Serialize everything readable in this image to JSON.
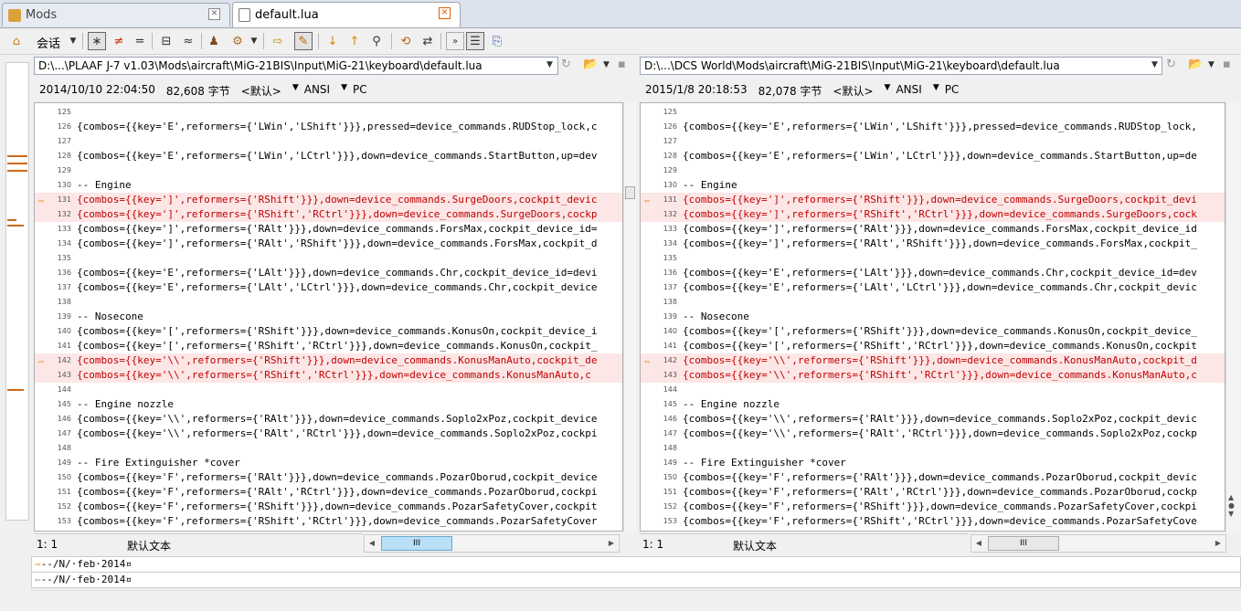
{
  "tabs": [
    {
      "label": "Mods",
      "active": false
    },
    {
      "label": "default.lua",
      "active": true
    }
  ],
  "toolbar": {
    "session_label": "会话",
    "icons": [
      "home-icon",
      "session-dropdown-icon",
      "show-all-icon",
      "show-diff-icon",
      "show-same-icon",
      "context-icon",
      "ignore-icon",
      "rules-icon",
      "format-icon",
      "next-section-icon",
      "edit-icon",
      "next-diff-icon",
      "prev-diff-icon",
      "find-icon",
      "sync-icon",
      "swap-icon",
      "expand-icon",
      "columns-icon",
      "refresh-icon"
    ]
  },
  "left": {
    "path": "D:\\...\\PLAAF J-7 v1.03\\Mods\\aircraft\\MiG-21BIS\\Input\\MiG-21\\keyboard\\default.lua",
    "date": "2014/10/10 22:04:50",
    "size": "82,608 字节",
    "encoding_default": "<默认>",
    "charset": "ANSI",
    "lineend": "PC",
    "status_pos": "1: 1",
    "status_text": "默认文本",
    "thumb_label": "III"
  },
  "right": {
    "path": "D:\\...\\DCS World\\Mods\\aircraft\\MiG-21BIS\\Input\\MiG-21\\keyboard\\default.lua",
    "date": "2015/1/8 20:18:53",
    "size": "82,078 字节",
    "encoding_default": "<默认>",
    "charset": "ANSI",
    "lineend": "PC",
    "status_pos": "1: 1",
    "status_text": "默认文本",
    "thumb_label": "III"
  },
  "left_lines": [
    {
      "n": "125",
      "t": "",
      "d": false
    },
    {
      "n": "126",
      "t": "{combos={{key='E',reformers={'LWin','LShift'}}},pressed=device_commands.RUDStop_lock,c",
      "d": false
    },
    {
      "n": "127",
      "t": "",
      "d": false
    },
    {
      "n": "128",
      "t": "{combos={{key='E',reformers={'LWin','LCtrl'}}},down=device_commands.StartButton,up=dev",
      "d": false
    },
    {
      "n": "129",
      "t": "",
      "d": false
    },
    {
      "n": "130",
      "t": "-- Engine",
      "d": false
    },
    {
      "n": "131",
      "t": "{combos={{key=']',reformers={'RShift'}}},down=device_commands.SurgeDoors,cockpit_devic",
      "d": true,
      "a": true
    },
    {
      "n": "132",
      "t": "{combos={{key=']',reformers={'RShift','RCtrl'}}},down=device_commands.SurgeDoors,cockp",
      "d": true
    },
    {
      "n": "133",
      "t": "{combos={{key=']',reformers={'RAlt'}}},down=device_commands.ForsMax,cockpit_device_id=",
      "d": false
    },
    {
      "n": "134",
      "t": "{combos={{key=']',reformers={'RAlt','RShift'}}},down=device_commands.ForsMax,cockpit_d",
      "d": false
    },
    {
      "n": "135",
      "t": "",
      "d": false
    },
    {
      "n": "136",
      "t": "{combos={{key='E',reformers={'LAlt'}}},down=device_commands.Chr,cockpit_device_id=devi",
      "d": false
    },
    {
      "n": "137",
      "t": "{combos={{key='E',reformers={'LAlt','LCtrl'}}},down=device_commands.Chr,cockpit_device",
      "d": false
    },
    {
      "n": "138",
      "t": "",
      "d": false
    },
    {
      "n": "139",
      "t": "-- Nosecone",
      "d": false
    },
    {
      "n": "140",
      "t": "{combos={{key='[',reformers={'RShift'}}},down=device_commands.KonusOn,cockpit_device_i",
      "d": false
    },
    {
      "n": "141",
      "t": "{combos={{key='[',reformers={'RShift','RCtrl'}}},down=device_commands.KonusOn,cockpit_",
      "d": false
    },
    {
      "n": "142",
      "t": "{combos={{key='\\\\',reformers={'RShift'}}},down=device_commands.KonusManAuto,cockpit_de",
      "d": true,
      "a": true
    },
    {
      "n": "143",
      "t": "{combos={{key='\\\\',reformers={'RShift','RCtrl'}}},down=device_commands.KonusManAuto,c",
      "d": true
    },
    {
      "n": "144",
      "t": "",
      "d": false
    },
    {
      "n": "145",
      "t": "-- Engine nozzle",
      "d": false
    },
    {
      "n": "146",
      "t": "{combos={{key='\\\\',reformers={'RAlt'}}},down=device_commands.Soplo2xPoz,cockpit_device",
      "d": false
    },
    {
      "n": "147",
      "t": "{combos={{key='\\\\',reformers={'RAlt','RCtrl'}}},down=device_commands.Soplo2xPoz,cockpi",
      "d": false
    },
    {
      "n": "148",
      "t": "",
      "d": false
    },
    {
      "n": "149",
      "t": "-- Fire Extinguisher *cover",
      "d": false
    },
    {
      "n": "150",
      "t": "{combos={{key='F',reformers={'RAlt'}}},down=device_commands.PozarOborud,cockpit_device",
      "d": false
    },
    {
      "n": "151",
      "t": "{combos={{key='F',reformers={'RAlt','RCtrl'}}},down=device_commands.PozarOborud,cockpi",
      "d": false
    },
    {
      "n": "152",
      "t": "{combos={{key='F',reformers={'RShift'}}},down=device_commands.PozarSafetyCover,cockpit",
      "d": false
    },
    {
      "n": "153",
      "t": "{combos={{key='F',reformers={'RShift','RCtrl'}}},down=device_commands.PozarSafetyCover",
      "d": false
    }
  ],
  "right_lines": [
    {
      "n": "125",
      "t": "",
      "d": false
    },
    {
      "n": "126",
      "t": "{combos={{key='E',reformers={'LWin','LShift'}}},pressed=device_commands.RUDStop_lock,",
      "d": false
    },
    {
      "n": "127",
      "t": "",
      "d": false
    },
    {
      "n": "128",
      "t": "{combos={{key='E',reformers={'LWin','LCtrl'}}},down=device_commands.StartButton,up=de",
      "d": false
    },
    {
      "n": "129",
      "t": "",
      "d": false
    },
    {
      "n": "130",
      "t": "-- Engine",
      "d": false
    },
    {
      "n": "131",
      "t": "{combos={{key=']',reformers={'RShift'}}},down=device_commands.SurgeDoors,cockpit_devi",
      "d": true,
      "a": true
    },
    {
      "n": "132",
      "t": "{combos={{key=']',reformers={'RShift','RCtrl'}}},down=device_commands.SurgeDoors,cock",
      "d": true
    },
    {
      "n": "133",
      "t": "{combos={{key=']',reformers={'RAlt'}}},down=device_commands.ForsMax,cockpit_device_id",
      "d": false
    },
    {
      "n": "134",
      "t": "{combos={{key=']',reformers={'RAlt','RShift'}}},down=device_commands.ForsMax,cockpit_",
      "d": false
    },
    {
      "n": "135",
      "t": "",
      "d": false
    },
    {
      "n": "136",
      "t": "{combos={{key='E',reformers={'LAlt'}}},down=device_commands.Chr,cockpit_device_id=dev",
      "d": false
    },
    {
      "n": "137",
      "t": "{combos={{key='E',reformers={'LAlt','LCtrl'}}},down=device_commands.Chr,cockpit_devic",
      "d": false
    },
    {
      "n": "138",
      "t": "",
      "d": false
    },
    {
      "n": "139",
      "t": "-- Nosecone",
      "d": false
    },
    {
      "n": "140",
      "t": "{combos={{key='[',reformers={'RShift'}}},down=device_commands.KonusOn,cockpit_device_",
      "d": false
    },
    {
      "n": "141",
      "t": "{combos={{key='[',reformers={'RShift','RCtrl'}}},down=device_commands.KonusOn,cockpit",
      "d": false
    },
    {
      "n": "142",
      "t": "{combos={{key='\\\\',reformers={'RShift'}}},down=device_commands.KonusManAuto,cockpit_d",
      "d": true,
      "a": true
    },
    {
      "n": "143",
      "t": "{combos={{key='\\\\',reformers={'RShift','RCtrl'}}},down=device_commands.KonusManAuto,c",
      "d": true
    },
    {
      "n": "144",
      "t": "",
      "d": false
    },
    {
      "n": "145",
      "t": "-- Engine nozzle",
      "d": false
    },
    {
      "n": "146",
      "t": "{combos={{key='\\\\',reformers={'RAlt'}}},down=device_commands.Soplo2xPoz,cockpit_devic",
      "d": false
    },
    {
      "n": "147",
      "t": "{combos={{key='\\\\',reformers={'RAlt','RCtrl'}}},down=device_commands.Soplo2xPoz,cockp",
      "d": false
    },
    {
      "n": "148",
      "t": "",
      "d": false
    },
    {
      "n": "149",
      "t": "-- Fire Extinguisher *cover",
      "d": false
    },
    {
      "n": "150",
      "t": "{combos={{key='F',reformers={'RAlt'}}},down=device_commands.PozarOborud,cockpit_devic",
      "d": false
    },
    {
      "n": "151",
      "t": "{combos={{key='F',reformers={'RAlt','RCtrl'}}},down=device_commands.PozarOborud,cockp",
      "d": false
    },
    {
      "n": "152",
      "t": "{combos={{key='F',reformers={'RShift'}}},down=device_commands.PozarSafetyCover,cockpi",
      "d": false
    },
    {
      "n": "153",
      "t": "{combos={{key='F',reformers={'RShift','RCtrl'}}},down=device_commands.PozarSafetyCove",
      "d": false
    }
  ],
  "bottom_lines": [
    "--/N/·feb·2014¤",
    "--/N/·feb·2014¤"
  ],
  "colors": {
    "diff_bg": "#fde6e6",
    "diff_text": "#c00000",
    "marker": "#cc6a1a",
    "arrow": "#d08a00"
  }
}
